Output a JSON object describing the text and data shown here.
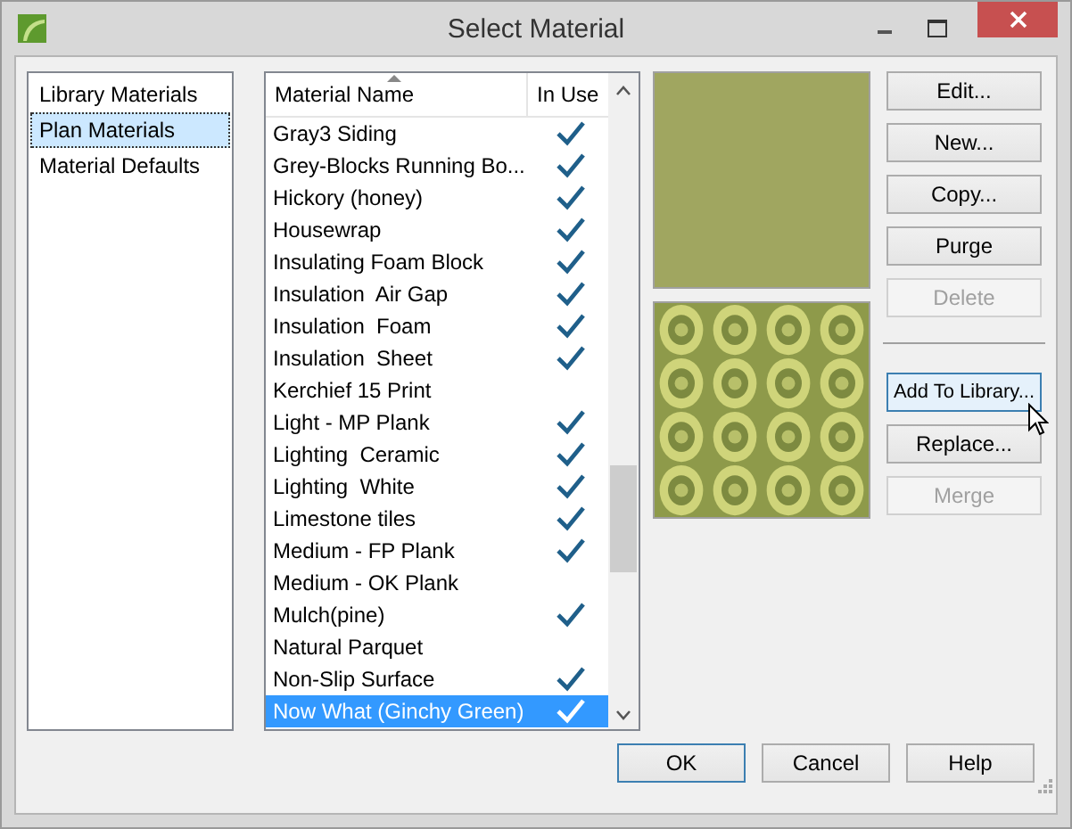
{
  "window": {
    "title": "Select Material"
  },
  "categories": [
    {
      "label": "Library Materials",
      "selected": false
    },
    {
      "label": "Plan Materials",
      "selected": true
    },
    {
      "label": "Material Defaults",
      "selected": false
    }
  ],
  "table": {
    "columns": [
      "Material Name",
      "In Use"
    ],
    "rows": [
      {
        "name": "Gray3 Siding",
        "in_use": true,
        "selected": false
      },
      {
        "name": "Grey-Blocks Running Bo...",
        "in_use": true,
        "selected": false
      },
      {
        "name": "Hickory (honey)",
        "in_use": true,
        "selected": false
      },
      {
        "name": "Housewrap",
        "in_use": true,
        "selected": false
      },
      {
        "name": "Insulating Foam Block",
        "in_use": true,
        "selected": false
      },
      {
        "name": "Insulation  Air Gap",
        "in_use": true,
        "selected": false
      },
      {
        "name": "Insulation  Foam",
        "in_use": true,
        "selected": false
      },
      {
        "name": "Insulation  Sheet",
        "in_use": true,
        "selected": false
      },
      {
        "name": "Kerchief 15 Print",
        "in_use": false,
        "selected": false
      },
      {
        "name": "Light - MP Plank",
        "in_use": true,
        "selected": false
      },
      {
        "name": "Lighting  Ceramic",
        "in_use": true,
        "selected": false
      },
      {
        "name": "Lighting  White",
        "in_use": true,
        "selected": false
      },
      {
        "name": "Limestone tiles",
        "in_use": true,
        "selected": false
      },
      {
        "name": "Medium - FP Plank",
        "in_use": true,
        "selected": false
      },
      {
        "name": "Medium - OK Plank",
        "in_use": false,
        "selected": false
      },
      {
        "name": "Mulch(pine)",
        "in_use": true,
        "selected": false
      },
      {
        "name": "Natural Parquet",
        "in_use": false,
        "selected": false
      },
      {
        "name": "Non-Slip Surface",
        "in_use": true,
        "selected": false
      },
      {
        "name": "Now What (Ginchy Green)",
        "in_use": true,
        "selected": true
      }
    ]
  },
  "preview": {
    "color": "#a0a660"
  },
  "side_buttons": [
    {
      "label": "Edit...",
      "disabled": false,
      "hovered": false
    },
    {
      "label": "New...",
      "disabled": false,
      "hovered": false
    },
    {
      "label": "Copy...",
      "disabled": false,
      "hovered": false
    },
    {
      "label": "Purge",
      "disabled": false,
      "hovered": false
    },
    {
      "label": "Delete",
      "disabled": true,
      "hovered": false
    },
    {
      "label": "Add To Library...",
      "disabled": false,
      "hovered": true
    },
    {
      "label": "Replace...",
      "disabled": false,
      "hovered": false
    },
    {
      "label": "Merge",
      "disabled": true,
      "hovered": false
    }
  ],
  "buttons": [
    {
      "label": "OK",
      "default": true
    },
    {
      "label": "Cancel",
      "default": false
    },
    {
      "label": "Help",
      "default": false
    }
  ]
}
